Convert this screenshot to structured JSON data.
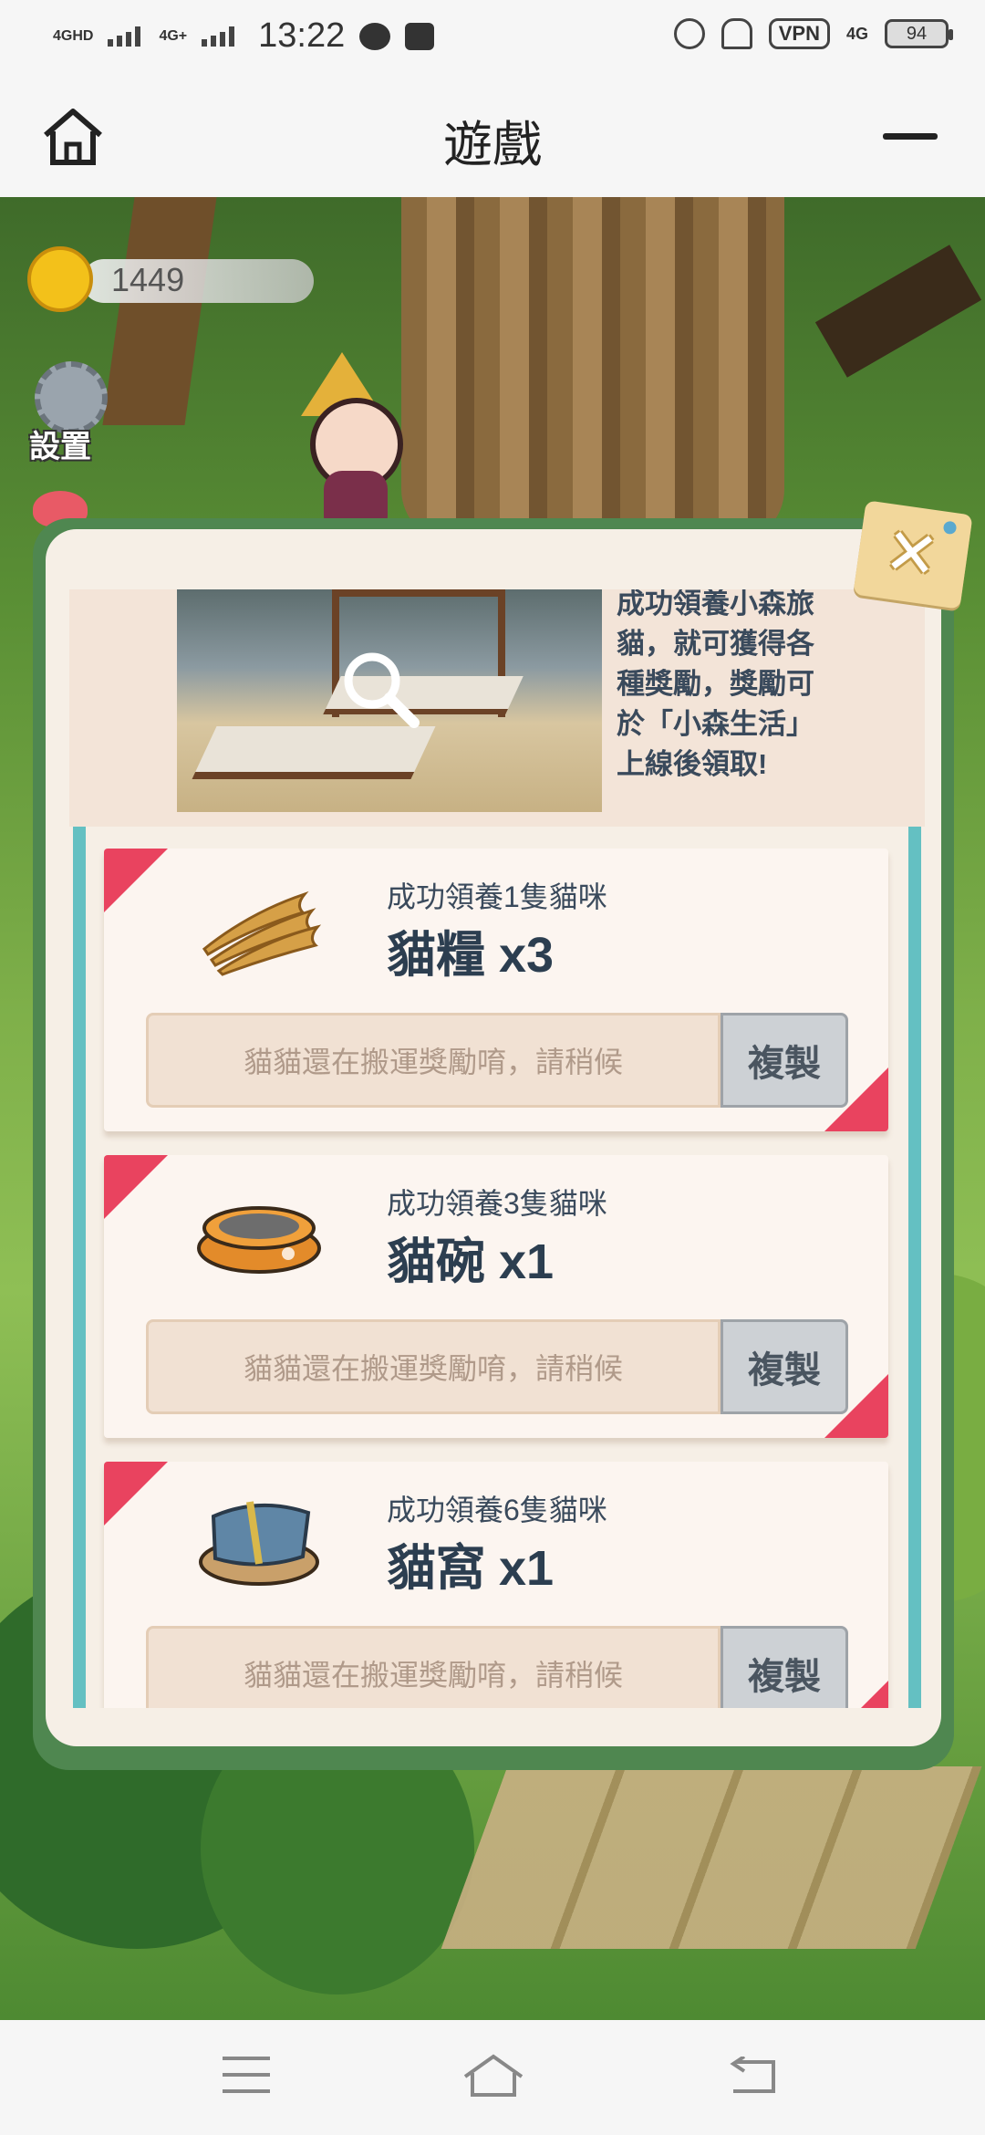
{
  "status_bar": {
    "signal1": "4GHD",
    "signal2": "4G+",
    "time": "13:22",
    "vpn": "VPN",
    "network": "4G",
    "battery": "94"
  },
  "header": {
    "title": "遊戲",
    "home_icon": "home-icon",
    "menu_icon": "minus-icon"
  },
  "game": {
    "coins": "1449",
    "settings_label": "設置",
    "intro_text": "成功領養小森旅\n貓，就可獲得各\n種獎勵，獎勵可\n於「小森生活」\n上線後領取!",
    "rewards": [
      {
        "condition": "成功領養1隻貓咪",
        "reward": "貓糧 x3",
        "code_placeholder": "貓貓還在搬運獎勵唷，請稍候",
        "copy_label": "複製",
        "icon": "fish-icon"
      },
      {
        "condition": "成功領養3隻貓咪",
        "reward": "貓碗 x1",
        "code_placeholder": "貓貓還在搬運獎勵唷，請稍候",
        "copy_label": "複製",
        "icon": "bowl-icon"
      },
      {
        "condition": "成功領養6隻貓咪",
        "reward": "貓窩 x1",
        "code_placeholder": "貓貓還在搬運獎勵唷，請稍候",
        "copy_label": "複製",
        "icon": "cat-bed-icon"
      }
    ]
  },
  "colors": {
    "frame": "#4f8750",
    "accent_red": "#e9435f",
    "teal": "#64c0c2"
  }
}
